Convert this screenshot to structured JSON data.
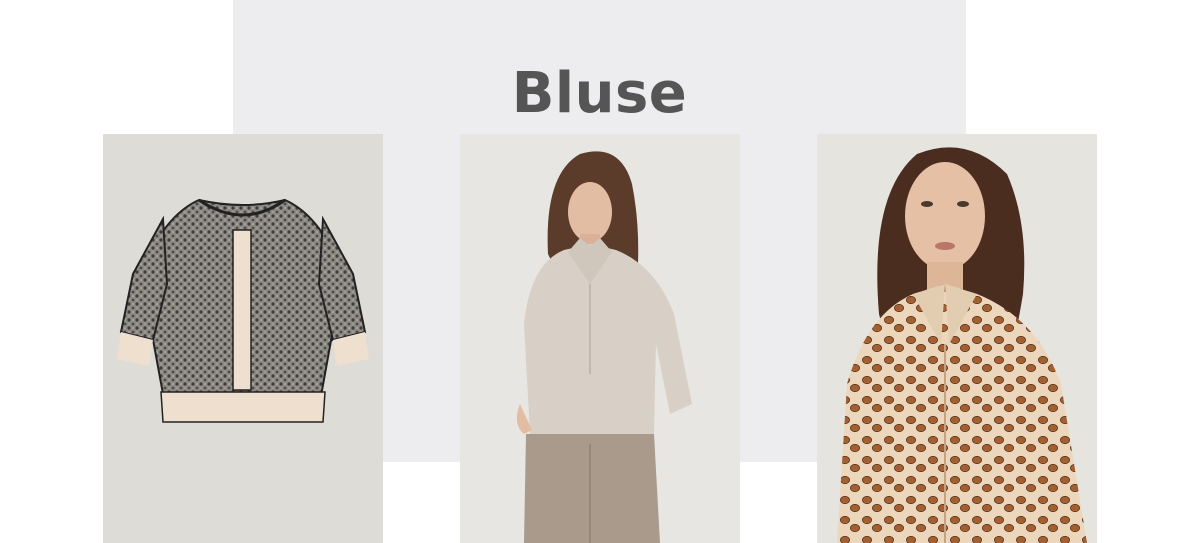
{
  "section": {
    "title": "Bluse"
  },
  "products": [
    {
      "image": "lace-print-blouse-flatlay",
      "background": "#dedcd7"
    },
    {
      "image": "champagne-satin-blouse-model",
      "background": "#e8e6e2"
    },
    {
      "image": "leopard-print-shirt-model",
      "background": "#e6e4df"
    }
  ]
}
